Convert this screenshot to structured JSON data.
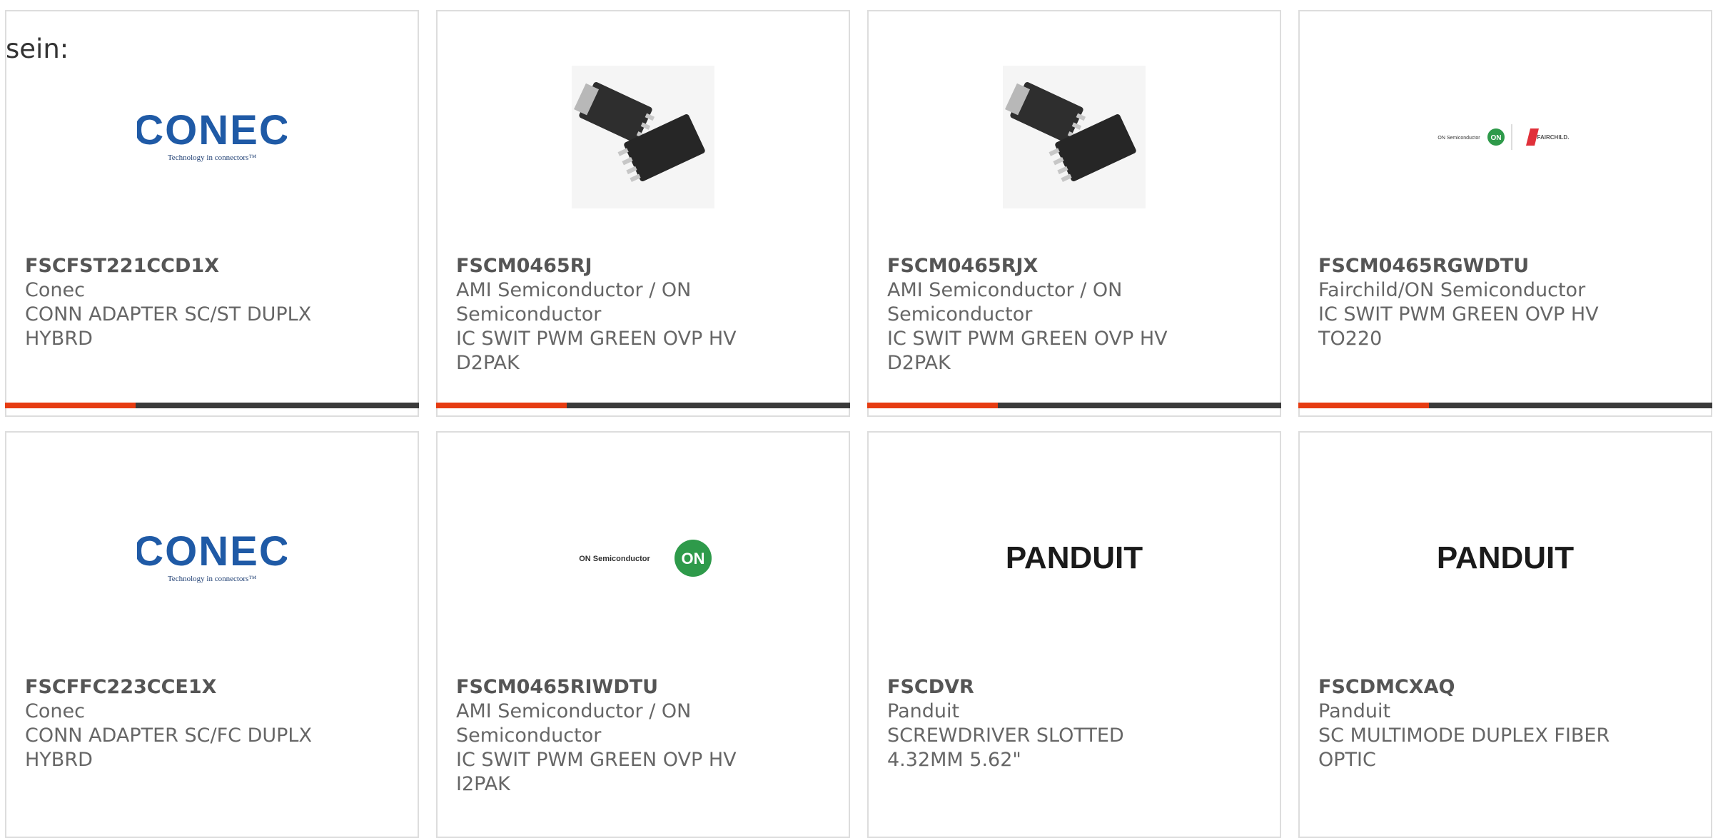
{
  "intro_text": "sein:",
  "colors": {
    "accent": "#e63c12",
    "bar": "#3a3a3a",
    "border": "#dddddd",
    "text": "#666666"
  },
  "products": [
    {
      "part": "FSCFST221CCD1X",
      "maker": "Conec",
      "desc": "CONN ADAPTER SC/ST DUPLX HYBRD",
      "image": "conec-logo",
      "logo_text": "CONEC",
      "logo_sub": "Technology in connectors™"
    },
    {
      "part": "FSCM0465RJ",
      "maker": "AMI Semiconductor / ON Semiconductor",
      "desc": "IC SWIT PWM GREEN OVP HV D2PAK",
      "image": "d2pak-chip-photo"
    },
    {
      "part": "FSCM0465RJX",
      "maker": "AMI Semiconductor / ON Semiconductor",
      "desc": "IC SWIT PWM GREEN OVP HV D2PAK",
      "image": "d2pak-chip-photo"
    },
    {
      "part": "FSCM0465RGWDTU",
      "maker": "Fairchild/ON Semiconductor",
      "desc": "IC SWIT PWM GREEN OVP HV TO220",
      "image": "on-fairchild-logo",
      "logo_text": "ON Semiconductor",
      "logo_sub": "FAIRCHILD."
    },
    {
      "part": "FSCFFC223CCE1X",
      "maker": "Conec",
      "desc": "CONN ADAPTER SC/FC DUPLX HYBRD",
      "image": "conec-logo",
      "logo_text": "CONEC",
      "logo_sub": "Technology in connectors™"
    },
    {
      "part": "FSCM0465RIWDTU",
      "maker": "AMI Semiconductor / ON Semiconductor",
      "desc": "IC SWIT PWM GREEN OVP HV I2PAK",
      "image": "on-semiconductor-logo",
      "logo_text": "ON Semiconductor",
      "logo_sub": "ON"
    },
    {
      "part": "FSCDVR",
      "maker": "Panduit",
      "desc": "SCREWDRIVER SLOTTED 4.32MM 5.62\"",
      "image": "panduit-logo",
      "logo_text": "PANDUIT"
    },
    {
      "part": "FSCDMCXAQ",
      "maker": "Panduit",
      "desc": "SC MULTIMODE DUPLEX FIBER OPTIC",
      "image": "panduit-logo",
      "logo_text": "PANDUIT"
    }
  ]
}
